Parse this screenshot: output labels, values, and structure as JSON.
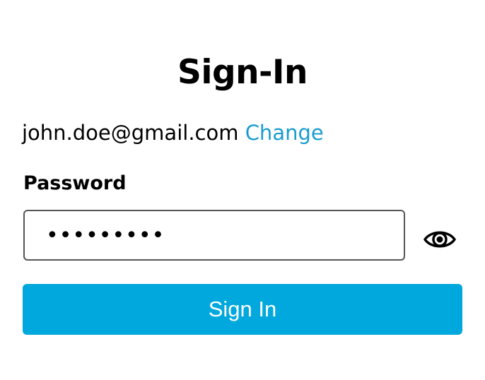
{
  "page": {
    "title": "Sign-In"
  },
  "account": {
    "email": "john.doe@gmail.com",
    "change_label": "Change"
  },
  "password": {
    "label": "Password",
    "value": "•••••••••",
    "toggle_icon": "eye-icon"
  },
  "actions": {
    "signin_label": "Sign In"
  },
  "colors": {
    "link": "#1a9ccf",
    "primary_button": "#00a8dd",
    "field_border": "#555555"
  }
}
